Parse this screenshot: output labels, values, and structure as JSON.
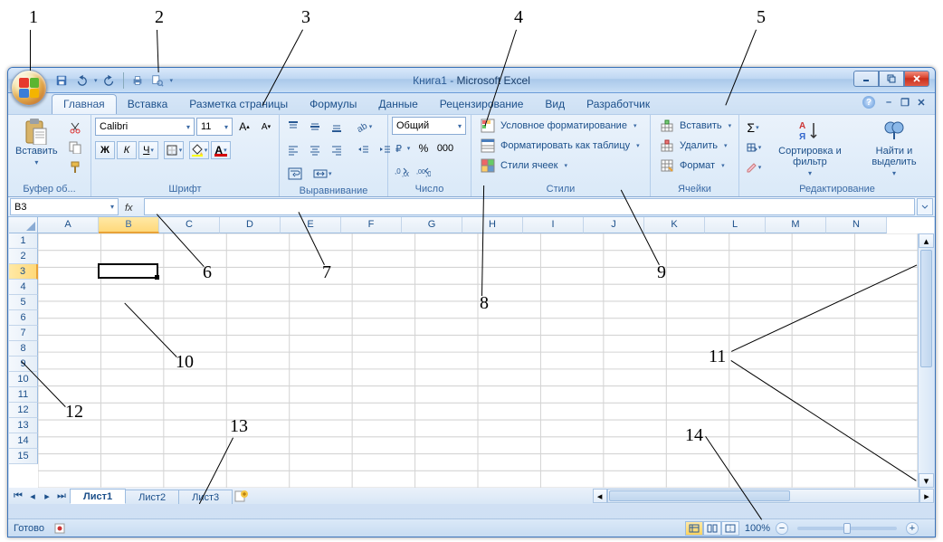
{
  "title": {
    "doc": "Книга1",
    "sep": " - ",
    "app": "Microsoft Excel"
  },
  "tabs": [
    "Главная",
    "Вставка",
    "Разметка страницы",
    "Формулы",
    "Данные",
    "Рецензирование",
    "Вид",
    "Разработчик"
  ],
  "active_tab": 0,
  "ribbon": {
    "clipboard": {
      "label": "Буфер об...",
      "paste": "Вставить"
    },
    "font": {
      "label": "Шрифт",
      "family": "Calibri",
      "size": "11",
      "bold": "Ж",
      "italic": "К",
      "underline": "Ч"
    },
    "alignment": {
      "label": "Выравнивание"
    },
    "number": {
      "label": "Число",
      "format": "Общий"
    },
    "styles": {
      "label": "Стили",
      "conditional": "Условное форматирование",
      "as_table": "Форматировать как таблицу",
      "cell_styles": "Стили ячеек"
    },
    "cells": {
      "label": "Ячейки",
      "insert": "Вставить",
      "delete": "Удалить",
      "format": "Формат"
    },
    "editing": {
      "label": "Редактирование",
      "sort": "Сортировка и фильтр",
      "find": "Найти и выделить"
    }
  },
  "namebox": "B3",
  "columns": [
    "A",
    "B",
    "C",
    "D",
    "E",
    "F",
    "G",
    "H",
    "I",
    "J",
    "K",
    "L",
    "M",
    "N"
  ],
  "rows": [
    "1",
    "2",
    "3",
    "4",
    "5",
    "6",
    "7",
    "8",
    "9",
    "10",
    "11",
    "12",
    "13",
    "14",
    "15"
  ],
  "active_col_idx": 1,
  "active_row_idx": 2,
  "sheets": [
    "Лист1",
    "Лист2",
    "Лист3"
  ],
  "active_sheet": 0,
  "status": {
    "ready": "Готово",
    "zoom": "100%"
  },
  "callouts": [
    "1",
    "2",
    "3",
    "4",
    "5",
    "6",
    "7",
    "8",
    "9",
    "10",
    "11",
    "12",
    "13",
    "14"
  ],
  "colors": {
    "accent": "#3b73b9",
    "sel": "#ffd97a"
  }
}
